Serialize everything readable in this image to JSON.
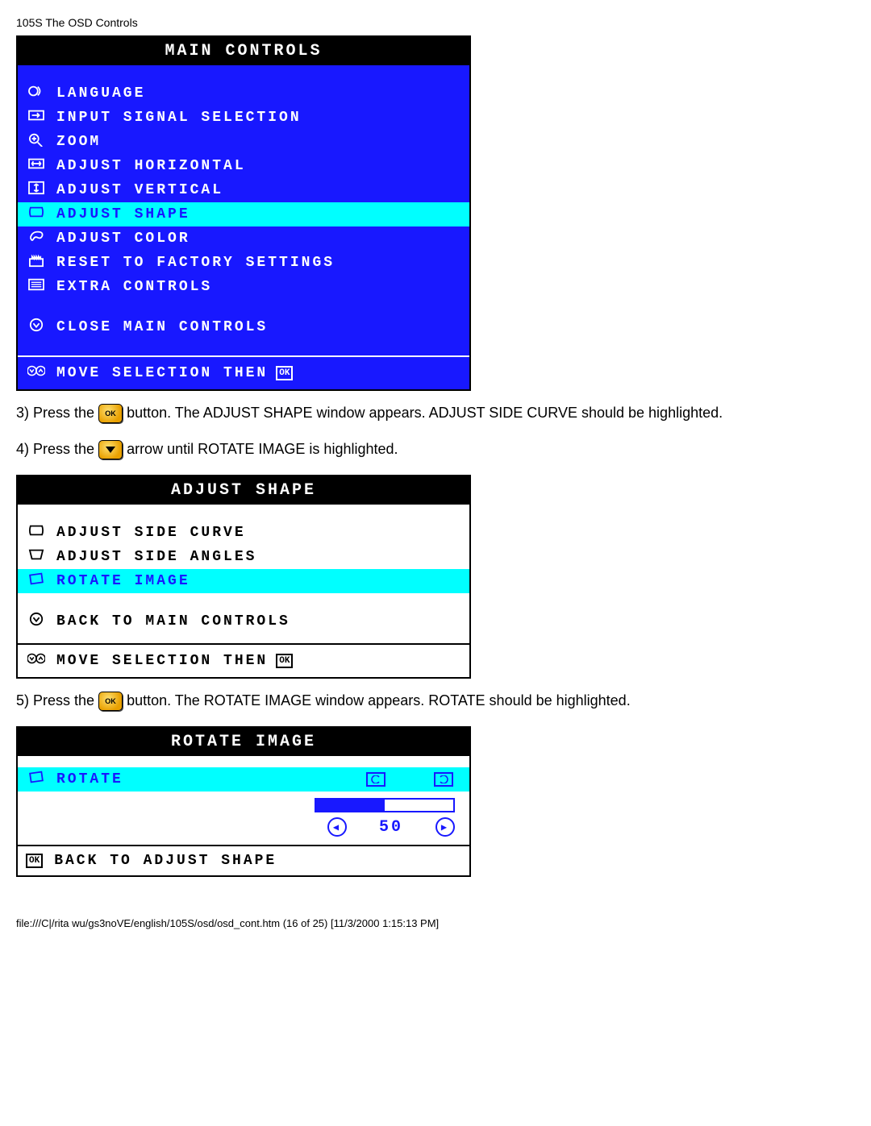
{
  "page_header": "105S The OSD Controls",
  "main_controls": {
    "title": "MAIN CONTROLS",
    "items": [
      {
        "label": "LANGUAGE",
        "icon": "language-icon"
      },
      {
        "label": "INPUT SIGNAL SELECTION",
        "icon": "input-icon"
      },
      {
        "label": "ZOOM",
        "icon": "zoom-icon"
      },
      {
        "label": "ADJUST HORIZONTAL",
        "icon": "horizontal-icon"
      },
      {
        "label": "ADJUST VERTICAL",
        "icon": "vertical-icon"
      },
      {
        "label": "ADJUST SHAPE",
        "icon": "shape-icon",
        "highlighted": true
      },
      {
        "label": "ADJUST COLOR",
        "icon": "color-icon"
      },
      {
        "label": "RESET TO FACTORY SETTINGS",
        "icon": "reset-icon"
      },
      {
        "label": "EXTRA CONTROLS",
        "icon": "extra-icon"
      }
    ],
    "close": "CLOSE MAIN CONTROLS",
    "footer": "MOVE SELECTION THEN"
  },
  "step3_pre": "3) Press the ",
  "step3_post": " button. The ADJUST SHAPE window appears. ADJUST SIDE CURVE should be highlighted.",
  "step4_pre": "4) Press the ",
  "step4_post": " arrow until ROTATE IMAGE is highlighted.",
  "adjust_shape": {
    "title": "ADJUST SHAPE",
    "items": [
      {
        "label": "ADJUST SIDE CURVE",
        "icon": "sidecurve-icon"
      },
      {
        "label": "ADJUST SIDE ANGLES",
        "icon": "sideangle-icon"
      },
      {
        "label": "ROTATE IMAGE",
        "icon": "rotate-icon",
        "highlighted": true
      }
    ],
    "back": "BACK TO MAIN CONTROLS",
    "footer": "MOVE SELECTION THEN"
  },
  "step5_pre": "5) Press the ",
  "step5_post": " button. The ROTATE IMAGE window appears. ROTATE should be highlighted.",
  "rotate_image": {
    "title": "ROTATE IMAGE",
    "item": "ROTATE",
    "value": "50",
    "back": "BACK TO ADJUST SHAPE"
  },
  "page_footer": "file:///C|/rita wu/gs3noVE/english/105S/osd/osd_cont.htm (16 of 25) [11/3/2000 1:15:13 PM]",
  "ok_label": "OK"
}
